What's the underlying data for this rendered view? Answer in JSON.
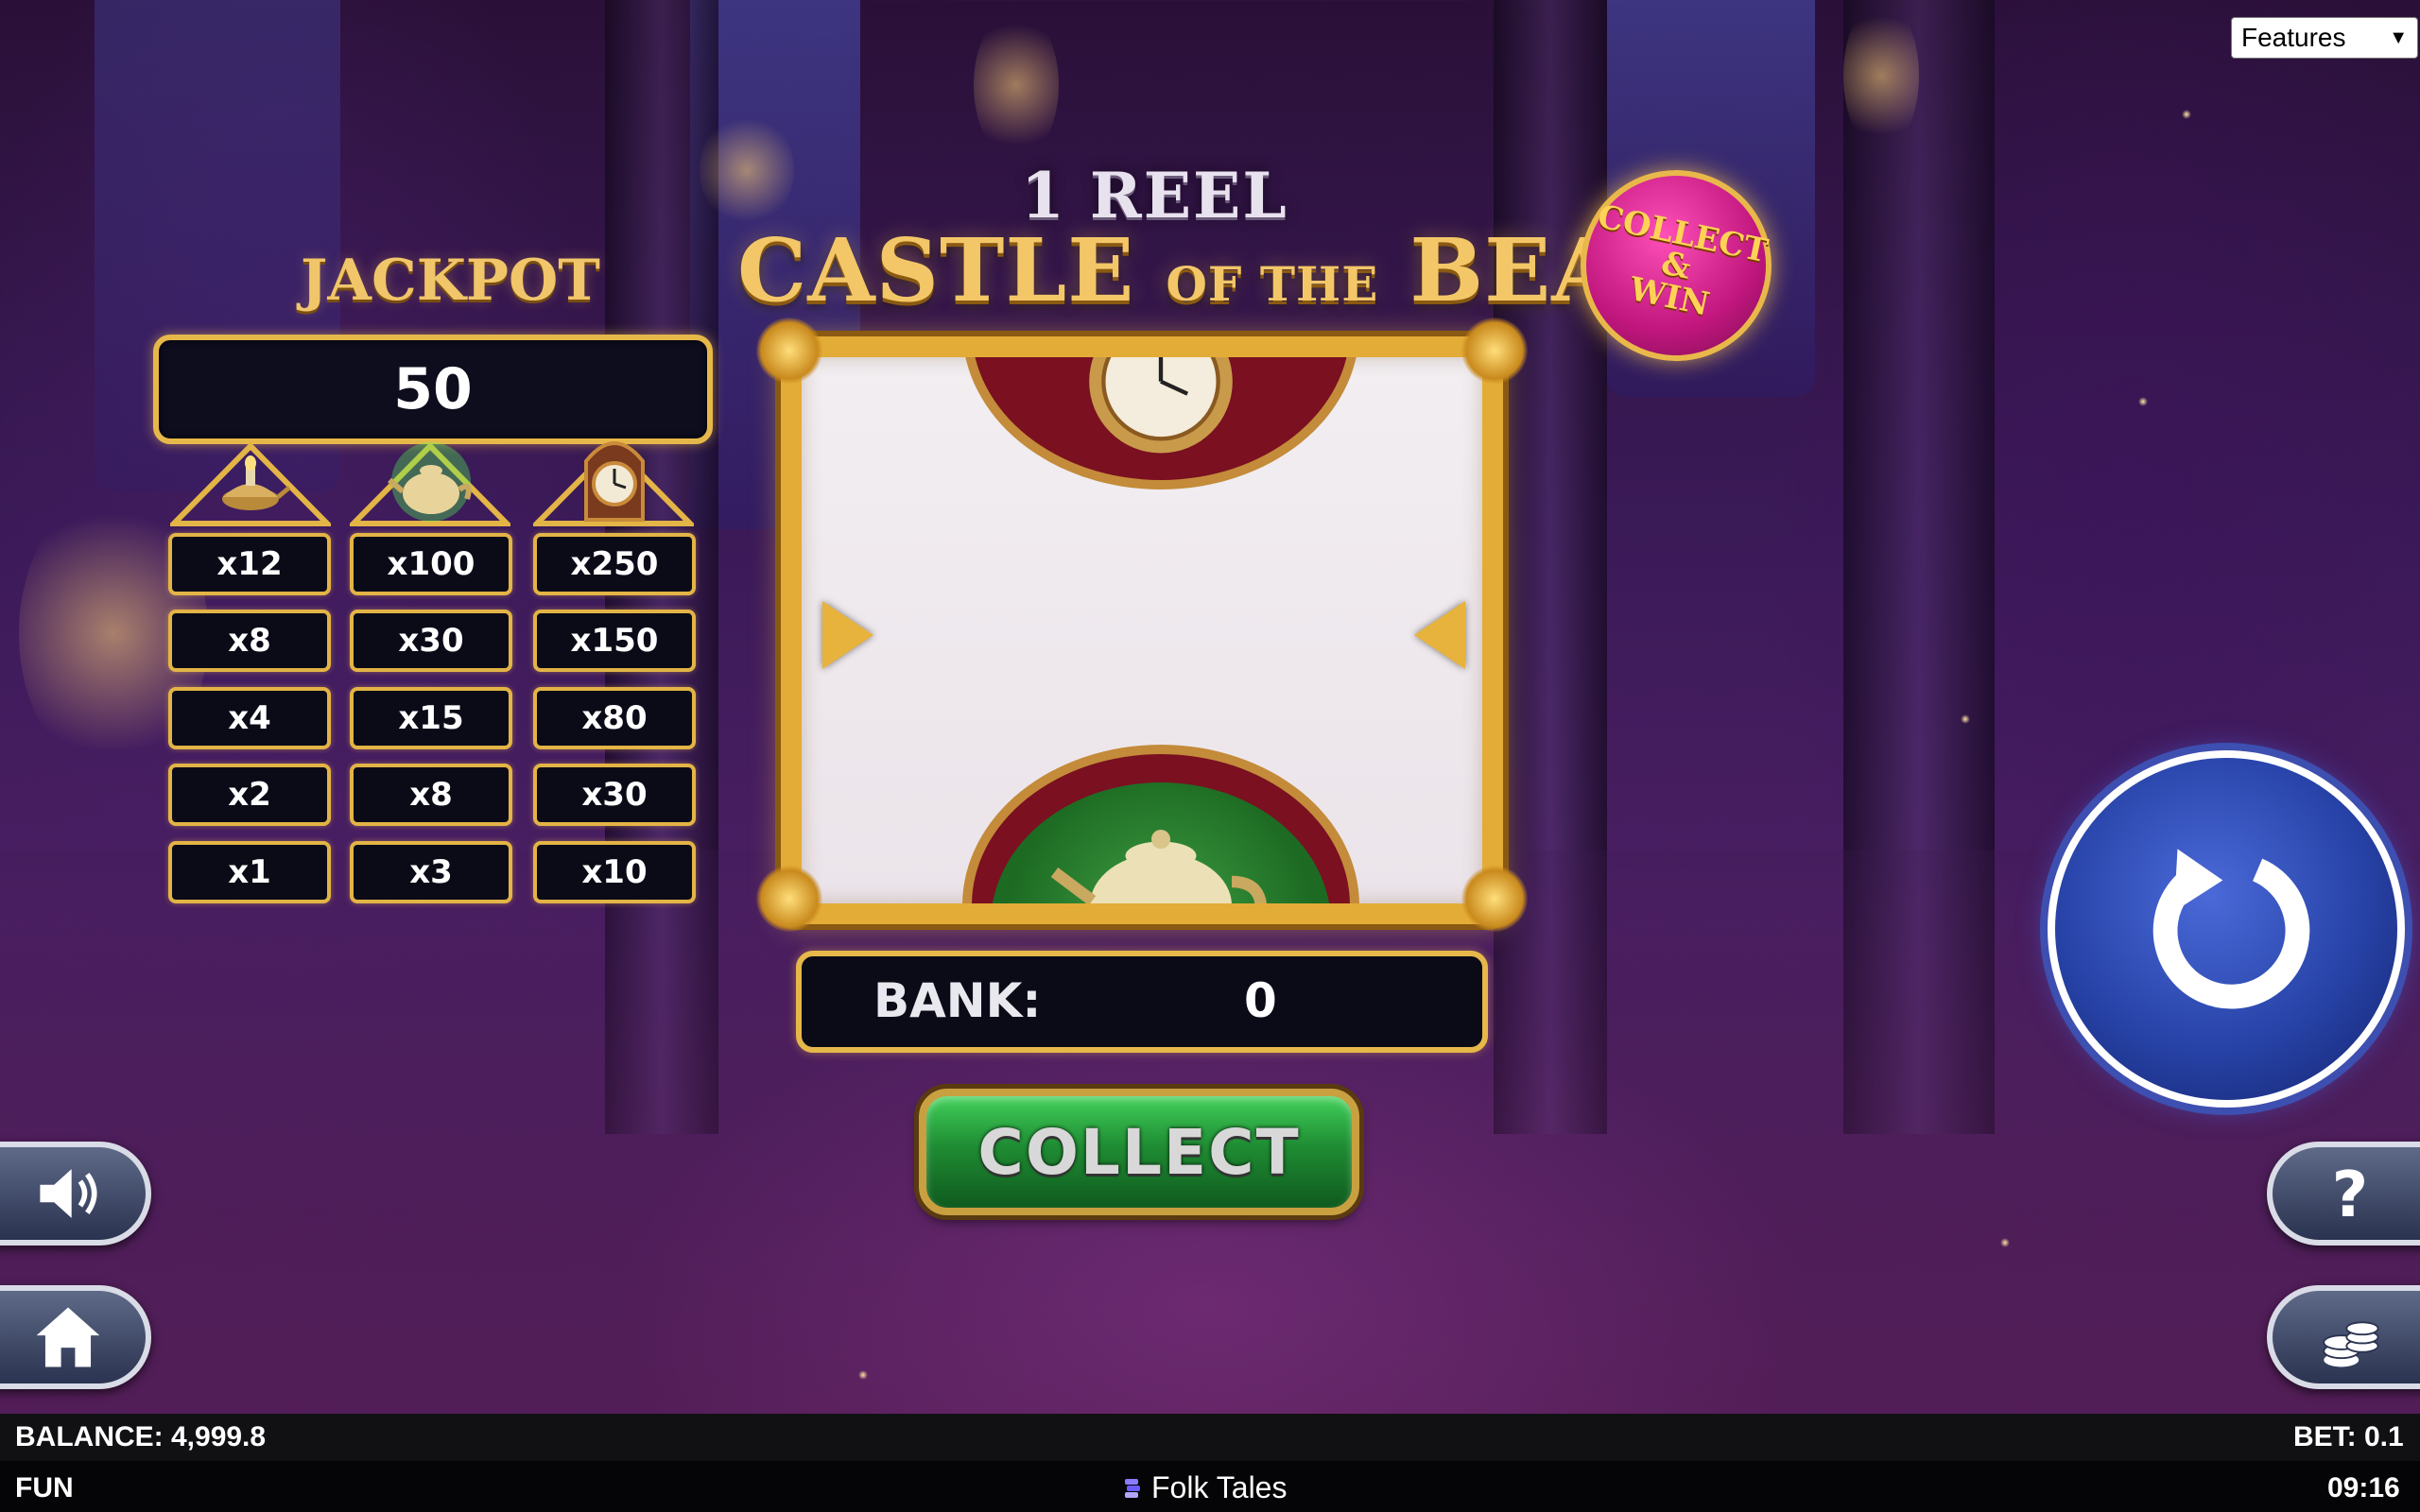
{
  "features_select": {
    "value": "Features",
    "options": [
      "Features"
    ]
  },
  "title": {
    "sub": "1 REEL",
    "main_1": "CASTLE",
    "main_2": "OF THE",
    "main_3": "BEAST"
  },
  "badge": {
    "line1": "COLLECT",
    "line2": "&",
    "line3": "WIN"
  },
  "jackpot": {
    "label": "JACKPOT",
    "value": "50"
  },
  "multiplier_columns": [
    {
      "symbol": "lamp-icon",
      "values": [
        "x12",
        "x8",
        "x4",
        "x2",
        "x1"
      ]
    },
    {
      "symbol": "teapot-icon",
      "values": [
        "x100",
        "x30",
        "x15",
        "x8",
        "x3"
      ]
    },
    {
      "symbol": "clock-icon",
      "values": [
        "x250",
        "x150",
        "x80",
        "x30",
        "x10"
      ]
    }
  ],
  "reel": {
    "top_symbol": "clock-icon",
    "bottom_symbol": "teapot-icon"
  },
  "bank": {
    "label": "BANK:",
    "value": "0"
  },
  "collect_button": {
    "label": "COLLECT"
  },
  "side_buttons": {
    "left": [
      "speaker-icon",
      "home-icon"
    ],
    "right": [
      "question-icon",
      "coins-icon"
    ]
  },
  "spin_button": {
    "icon": "spin-icon"
  },
  "footer": {
    "balance": "BALANCE: 4,999.8",
    "bet": "BET: 0.1",
    "mode": "FUN",
    "brand": "Folk Tales",
    "time": "09:16"
  },
  "colors": {
    "gold": "#e3b446",
    "spin_blue": "#2743a8",
    "collect_green": "#1f8c33",
    "badge_pink": "#c0167d"
  }
}
